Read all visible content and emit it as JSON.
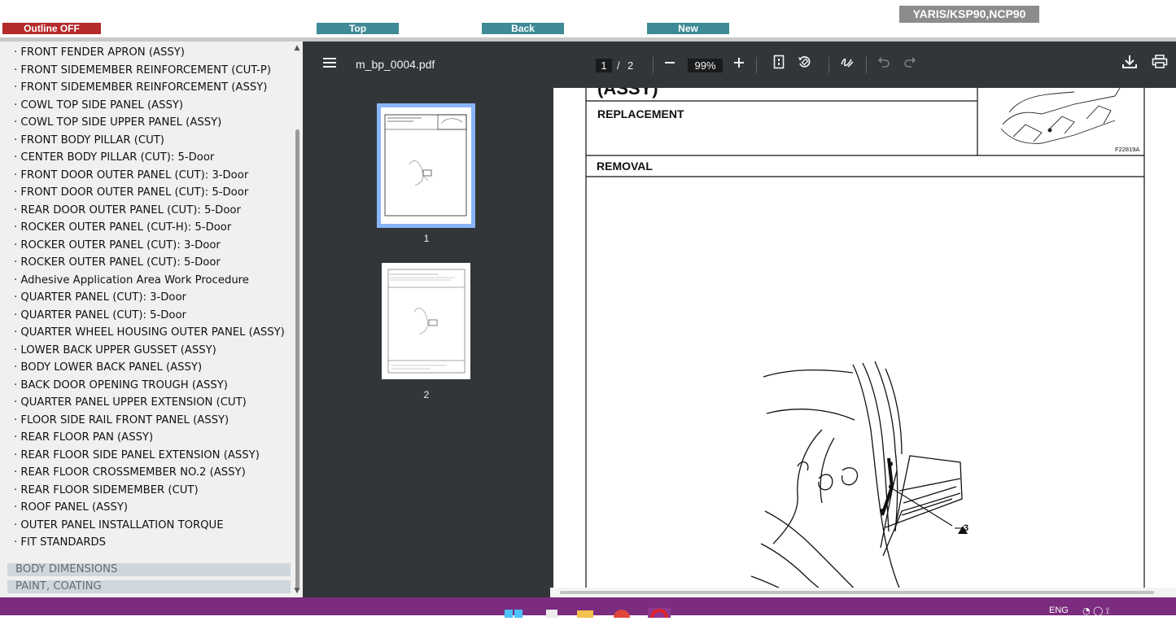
{
  "header": {
    "outline_button": "Outline OFF",
    "top_button": "Top",
    "back_button": "Back",
    "new_button": "New",
    "model": "YARIS/KSP90,NCP90"
  },
  "sidebar": {
    "items": [
      "FRONT FENDER APRON (ASSY)",
      "FRONT SIDEMEMBER REINFORCEMENT (CUT-P)",
      "FRONT SIDEMEMBER REINFORCEMENT (ASSY)",
      "COWL TOP SIDE PANEL (ASSY)",
      "COWL TOP SIDE UPPER PANEL (ASSY)",
      "FRONT BODY PILLAR (CUT)",
      "CENTER BODY PILLAR (CUT): 5-Door",
      "FRONT DOOR OUTER PANEL (CUT): 3-Door",
      "FRONT DOOR OUTER PANEL (CUT): 5-Door",
      "REAR DOOR OUTER PANEL (CUT): 5-Door",
      "ROCKER OUTER PANEL (CUT-H): 5-Door",
      "ROCKER OUTER PANEL (CUT): 3-Door",
      "ROCKER OUTER PANEL (CUT): 5-Door",
      "Adhesive Application Area Work Procedure",
      "QUARTER PANEL (CUT): 3-Door",
      "QUARTER PANEL (CUT): 5-Door",
      "QUARTER WHEEL HOUSING OUTER PANEL (ASSY)",
      "LOWER BACK UPPER GUSSET (ASSY)",
      "BODY LOWER BACK PANEL (ASSY)",
      "BACK DOOR OPENING TROUGH (ASSY)",
      "QUARTER PANEL UPPER EXTENSION (CUT)",
      "FLOOR SIDE RAIL FRONT PANEL (ASSY)",
      "REAR FLOOR PAN (ASSY)",
      "REAR FLOOR SIDE PANEL EXTENSION (ASSY)",
      "REAR FLOOR CROSSMEMBER NO.2 (ASSY)",
      "REAR FLOOR SIDEMEMBER (CUT)",
      "ROOF PANEL (ASSY)",
      "OUTER PANEL INSTALLATION TORQUE",
      "FIT STANDARDS"
    ],
    "sections": {
      "body_dimensions": "BODY DIMENSIONS",
      "paint_coating": "PAINT, COATING"
    }
  },
  "pdf_viewer": {
    "file_name": "m_bp_0004.pdf",
    "current_page": "1",
    "page_separator": "/",
    "total_pages": "2",
    "zoom": "99%",
    "thumbnails": [
      {
        "label": "1",
        "selected": true
      },
      {
        "label": "2",
        "selected": false
      }
    ],
    "icons": {
      "menu": "menu-icon",
      "zoom_out": "zoom-out-icon",
      "zoom_in": "zoom-in-icon",
      "fit_page": "fit-page-icon",
      "rotate": "rotate-icon",
      "annotate": "draw-icon",
      "undo": "undo-icon",
      "redo": "redo-icon",
      "download": "download-icon",
      "print": "print-icon"
    }
  },
  "document": {
    "title_fragment": "(ASSY)",
    "replacement_heading": "REPLACEMENT",
    "removal_heading": "REMOVAL",
    "figure_code": "F22819A",
    "callout": "—3"
  },
  "taskbar": {
    "language": "ENG"
  },
  "colors": {
    "outline_button": "#b52a2a",
    "nav_button": "#3e8a96",
    "model_badge": "#8c8c8c",
    "viewer_toolbar": "#323639",
    "thumbnail_selected": "#8ab4f8",
    "taskbar": "#7b2c7e"
  }
}
